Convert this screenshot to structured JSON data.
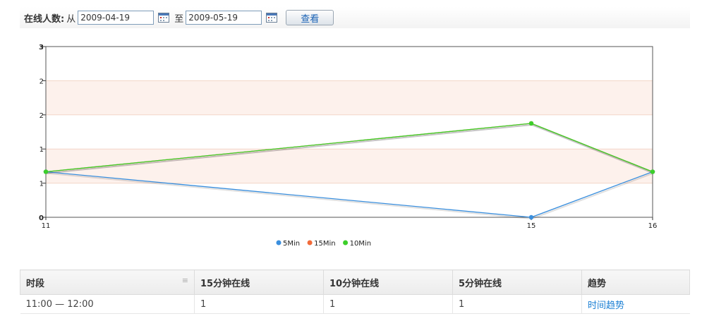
{
  "filter": {
    "label": "在线人数:",
    "from_label": "从",
    "from_date": "2009-04-19",
    "to_label": "至",
    "to_date": "2009-05-19",
    "search_button": "查看"
  },
  "chart_data": {
    "type": "line",
    "x": [
      11,
      15,
      16
    ],
    "x_tick_labels": [
      "11",
      "15",
      "16"
    ],
    "y_tick_labels": [
      "0",
      "1",
      "1",
      "2",
      "2",
      "3"
    ],
    "ylim": [
      0,
      3
    ],
    "series": [
      {
        "name": "5Min",
        "color": "#3a8fde",
        "values": [
          0.8,
          0,
          0.8
        ]
      },
      {
        "name": "15Min",
        "color": "#f26b3a",
        "values": [
          0.8,
          1.65,
          0.8
        ]
      },
      {
        "name": "10Min",
        "color": "#3ccf2a",
        "values": [
          0.8,
          1.65,
          0.8
        ]
      }
    ],
    "legend_position": "bottom-center",
    "band_color": "#fdf1ec"
  },
  "table": {
    "headers": [
      "时段",
      "15分钟在线",
      "10分钟在线",
      "5分钟在线",
      "趋势"
    ],
    "rows": [
      {
        "period": "11:00 — 12:00",
        "m15": "1",
        "m10": "1",
        "m5": "1",
        "trend": "时间趋势"
      }
    ]
  }
}
